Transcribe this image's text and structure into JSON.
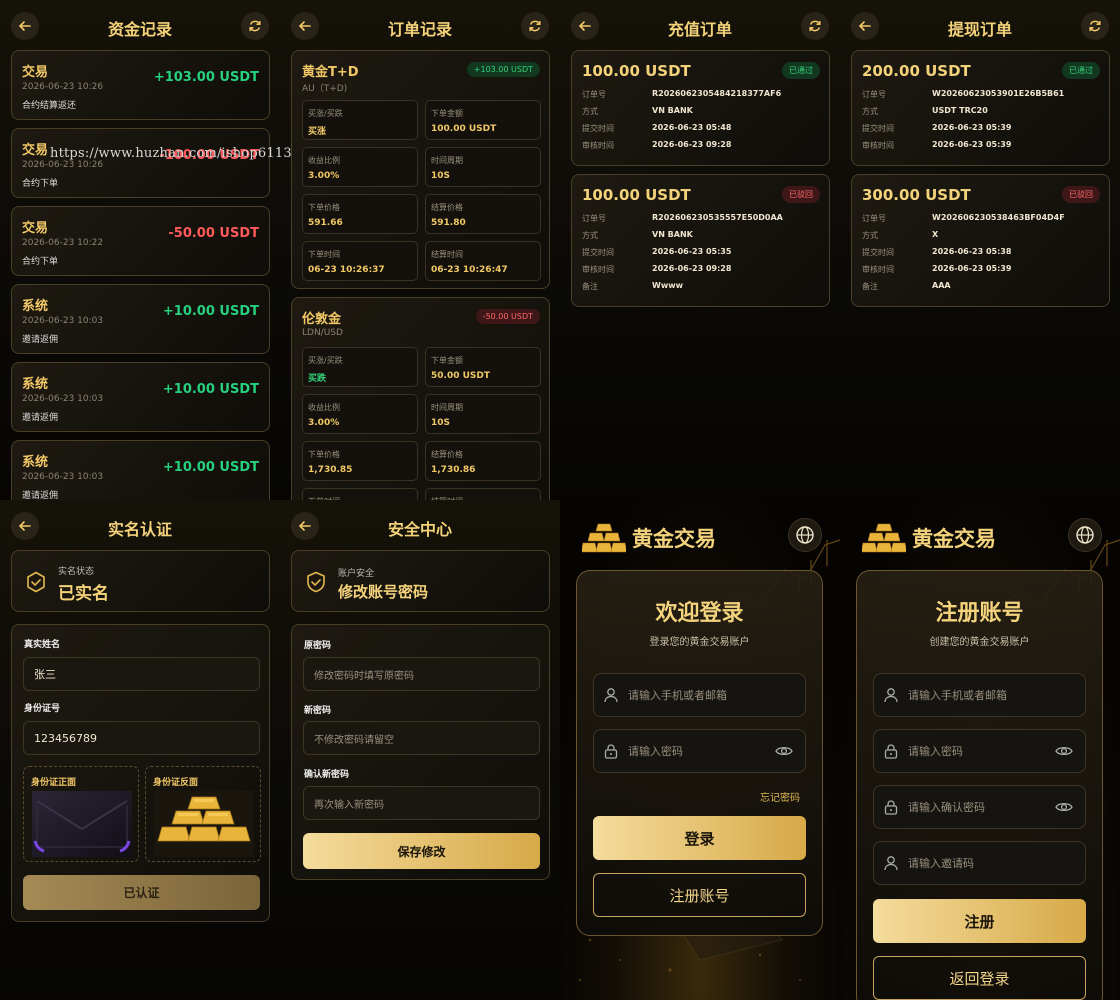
{
  "watermark": "https://www.huzhan.com/ishop6113",
  "fund_records": {
    "title": "资金记录",
    "items": [
      {
        "type": "交易",
        "time": "2026-06-23 10:26",
        "desc": "合约结算返还",
        "amount": "+103.00 USDT",
        "positive": true
      },
      {
        "type": "交易",
        "time": "2026-06-23 10:26",
        "desc": "合约下单",
        "amount": "-100.00 USDT",
        "positive": false
      },
      {
        "type": "交易",
        "time": "2026-06-23 10:22",
        "desc": "合约下单",
        "amount": "-50.00 USDT",
        "positive": false
      },
      {
        "type": "系统",
        "time": "2026-06-23 10:03",
        "desc": "邀请返佣",
        "amount": "+10.00 USDT",
        "positive": true
      },
      {
        "type": "系统",
        "time": "2026-06-23 10:03",
        "desc": "邀请返佣",
        "amount": "+10.00 USDT",
        "positive": true
      },
      {
        "type": "系统",
        "time": "2026-06-23 10:03",
        "desc": "邀请返佣",
        "amount": "+10.00 USDT",
        "positive": true
      }
    ]
  },
  "order_records": {
    "title": "订单记录",
    "orders": [
      {
        "name": "黄金T+D",
        "symbol": "AU（T+D)",
        "badge": "+103.00 USDT",
        "cells": [
          {
            "k": "买涨/买跌",
            "v": "买涨"
          },
          {
            "k": "下单金额",
            "v": "100.00 USDT"
          },
          {
            "k": "收益比例",
            "v": "3.00%"
          },
          {
            "k": "时间周期",
            "v": "10S"
          },
          {
            "k": "下单价格",
            "v": "591.66"
          },
          {
            "k": "结算价格",
            "v": "591.80"
          },
          {
            "k": "下单时间",
            "v": "06-23 10:26:37"
          },
          {
            "k": "结算时间",
            "v": "06-23 10:26:47"
          }
        ]
      },
      {
        "name": "伦敦金",
        "symbol": "LDN/USD",
        "badge": "-50.00 USDT",
        "cells": [
          {
            "k": "买涨/买跌",
            "v": "买跌"
          },
          {
            "k": "下单金额",
            "v": "50.00 USDT"
          },
          {
            "k": "收益比例",
            "v": "3.00%"
          },
          {
            "k": "时间周期",
            "v": "10S"
          },
          {
            "k": "下单价格",
            "v": "1,730.85"
          },
          {
            "k": "结算价格",
            "v": "1,730.86"
          },
          {
            "k": "下单时间",
            "v": ""
          },
          {
            "k": "结算时间",
            "v": ""
          }
        ]
      }
    ]
  },
  "recharge_orders": {
    "title": "充值订单",
    "labels": {
      "order_no": "订单号",
      "method": "方式",
      "submit_time": "提交时间",
      "review_time": "审核时间",
      "remark": "备注"
    },
    "items": [
      {
        "amount": "100.00 USDT",
        "status": "已通过",
        "order_no": "R2026062305484218377AF6",
        "method": "VN BANK",
        "submit_time": "2026-06-23 05:48",
        "review_time": "2026-06-23 09:28"
      },
      {
        "amount": "100.00 USDT",
        "status": "已驳回",
        "order_no": "R202606230535557E50D0AA",
        "method": "VN BANK",
        "submit_time": "2026-06-23 05:35",
        "review_time": "2026-06-23 09:28",
        "remark": "Wwww"
      }
    ]
  },
  "withdraw_orders": {
    "title": "提现订单",
    "labels": {
      "order_no": "订单号",
      "method": "方式",
      "submit_time": "提交时间",
      "review_time": "审核时间",
      "remark": "备注"
    },
    "items": [
      {
        "amount": "200.00 USDT",
        "status": "已通过",
        "order_no": "W20260623053901E26B5B61",
        "method": "USDT TRC20",
        "submit_time": "2026-06-23 05:39",
        "review_time": "2026-06-23 05:39"
      },
      {
        "amount": "300.00 USDT",
        "status": "已驳回",
        "order_no": "W202606230538463BF04D4F",
        "method": "X",
        "submit_time": "2026-06-23 05:38",
        "review_time": "2026-06-23 05:39",
        "remark": "AAA"
      }
    ]
  },
  "kyc": {
    "title": "实名认证",
    "status_label": "实名状态",
    "status_value": "已实名",
    "name_label": "真实姓名",
    "name_value": "张三",
    "id_label": "身份证号",
    "id_value": "123456789",
    "front_label": "身份证正面",
    "back_label": "身份证反面",
    "button": "已认证"
  },
  "security": {
    "title": "安全中心",
    "section_label": "账户安全",
    "section_value": "修改账号密码",
    "old_label": "原密码",
    "old_placeholder": "修改密码时填写原密码",
    "new_label": "新密码",
    "new_placeholder": "不修改密码请留空",
    "confirm_label": "确认新密码",
    "confirm_placeholder": "再次输入新密码",
    "button": "保存修改"
  },
  "login": {
    "brand": "黄金交易",
    "title": "欢迎登录",
    "subtitle": "登录您的黄金交易账户",
    "account_placeholder": "请输入手机或者邮箱",
    "password_placeholder": "请输入密码",
    "forgot": "忘记密码",
    "login_button": "登录",
    "register_button": "注册账号"
  },
  "register": {
    "brand": "黄金交易",
    "title": "注册账号",
    "subtitle": "创建您的黄金交易账户",
    "account_placeholder": "请输入手机或者邮箱",
    "password_placeholder": "请输入密码",
    "confirm_placeholder": "请输入确认密码",
    "invite_placeholder": "请输入邀请码",
    "register_button": "注册",
    "back_button": "返回登录"
  },
  "colors": {
    "gold": "#f3d27a",
    "positive": "#26d07c",
    "negative": "#ff5a5a",
    "background": "#0b0a07"
  }
}
